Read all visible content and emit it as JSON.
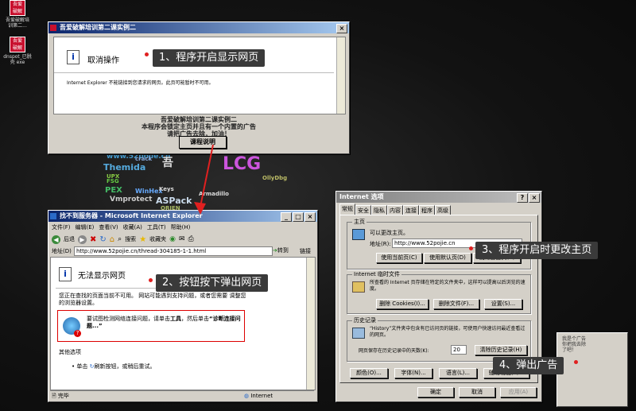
{
  "desktop": {
    "icons": [
      {
        "badge": "吾爱\n破解",
        "label": "吾爱破解培\n训第二..."
      },
      {
        "badge": "吾爱\n破解",
        "label": "dnspot_已脱\n壳 exe"
      }
    ],
    "logo_words": [
      "www.52pojie.cn",
      "Themida",
      "PEX",
      "FSG",
      "UPX",
      "Vmprotect",
      "WinHex",
      "ASPack",
      "LCG",
      "吾",
      "OllyDbg",
      "Armadillo",
      "crack",
      "ORIEN",
      "Keys"
    ]
  },
  "dialog": {
    "title": "吾爱破解培训第二课实例二",
    "cancel_text": "取消操作",
    "ie_message": "Internet Explorer 不能链接到您请求的网页。此页可能暂时不可用。",
    "body_lines": [
      "吾爱破解培训第二课实例二",
      "本程序会锁定主页并且有一个内置的广告",
      "请把广告去除，加油！"
    ],
    "button": "课程说明"
  },
  "ie_window": {
    "title": "找不到服务器 - Microsoft Internet Explorer",
    "menu": [
      "文件(F)",
      "编辑(E)",
      "查看(V)",
      "收藏(A)",
      "工具(T)",
      "帮助(H)"
    ],
    "toolbar": {
      "back": "后退",
      "search": "搜索",
      "favorites": "收藏夹"
    },
    "address_label": "地址(D)",
    "address": "http://www.52pojie.cn/thread-304185-1-1.html",
    "go": "转到",
    "links": "链接",
    "heading": "无法显示网页",
    "para1": "您正在查找的页面当前不可用。 网站可能遇到支持问题，或者您需要 调整您的浏览器设置。",
    "diag_text_a": "要试图检测网络连接问题，请单击",
    "diag_text_bold": "工具",
    "diag_text_b": "，然后单击",
    "diag_text_link": "“诊断连接问题...”",
    "other_options": "其他选项",
    "bullet1_a": "单击",
    "bullet1_b": "刷新按钮，或稍后重试。",
    "status_left": "完毕",
    "status_right": "Internet"
  },
  "options_window": {
    "title": "Internet 选项",
    "tabs": [
      "常规",
      "安全",
      "隐私",
      "内容",
      "连接",
      "程序",
      "高级"
    ],
    "home": {
      "group": "主页",
      "hint": "可以更改主页。",
      "address_label": "地址(R):",
      "address": "http://www.52pojie.cn",
      "buttons": [
        "使用当前页(C)",
        "使用默认页(D)",
        "使用空白页(B)"
      ]
    },
    "temp": {
      "group": "Internet 临时文件",
      "text": "所查看的 Internet 页存储在特定的文件夹中，这样可以提高以后浏览的速度。",
      "buttons": [
        "删除 Cookies(I)...",
        "删除文件(F)...",
        "设置(S)..."
      ]
    },
    "history": {
      "group": "历史记录",
      "text": "“History”文件夹中包含有已访问页的链接，可使用户快速访问最近查看过的网页。",
      "days_label": "网页保存在历史记录中的天数(K):",
      "days": "20",
      "clear": "清除历史记录(H)"
    },
    "bottom_buttons": [
      "颜色(O)...",
      "字体(N)...",
      "语言(L)...",
      "辅助功能(E)..."
    ],
    "ok": "确定",
    "cancel": "取消",
    "apply": "应用(A)"
  },
  "ad_popup": {
    "lines": [
      "我是个广告",
      "你把我去除",
      "了吧！"
    ]
  },
  "callouts": {
    "c1": "1、程序开启显示网页",
    "c2": "2、按钮按下弹出网页",
    "c3": "3、程序开启时更改主页",
    "c4": "4、弹出广告"
  },
  "colors": {
    "callout_bg": "#3a3a3a",
    "dot": "#e02020",
    "arrow": "#e02020",
    "titlebar": "#0a246a"
  }
}
